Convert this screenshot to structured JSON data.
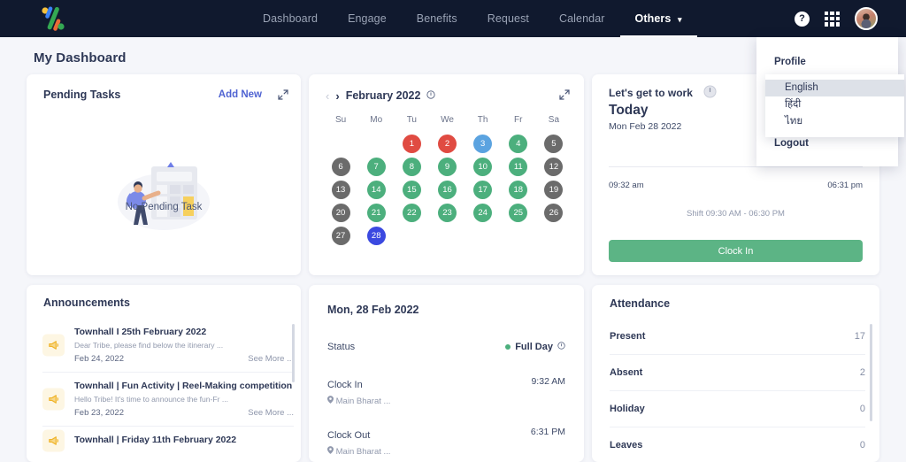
{
  "nav": {
    "logo_name": "percent-logo",
    "links": [
      {
        "label": "Dashboard",
        "active": false
      },
      {
        "label": "Engage",
        "active": false
      },
      {
        "label": "Benefits",
        "active": false
      },
      {
        "label": "Request",
        "active": false
      },
      {
        "label": "Calendar",
        "active": false
      },
      {
        "label": "Others",
        "active": true
      }
    ],
    "help_label": "?",
    "apps_icon": "grid-apps-icon",
    "avatar_icon": "user-avatar"
  },
  "profile_menu": {
    "profile_label": "Profile",
    "logout_label": "Logout",
    "languages": [
      {
        "label": "English",
        "selected": true
      },
      {
        "label": "हिंदी",
        "selected": false
      },
      {
        "label": "ไทย",
        "selected": false
      }
    ]
  },
  "page": {
    "title": "My Dashboard"
  },
  "pending_tasks": {
    "title": "Pending Tasks",
    "add_new": "Add New",
    "empty_text": "No Pending Task",
    "expand_icon": "expand-icon"
  },
  "announcements": {
    "title": "Announcements",
    "items": [
      {
        "title": "Townhall I 25th February 2022",
        "desc": "Dear Tribe, please find below the itinerary ...",
        "date": "Feb 24, 2022",
        "more": "See More ..."
      },
      {
        "title": "Townhall | Fun Activity | Reel-Making competition",
        "desc": "Hello Tribe! It's time to announce the fun-Fr ...",
        "date": "Feb 23, 2022",
        "more": "See More ..."
      },
      {
        "title": "Townhall | Friday 11th February 2022",
        "desc": "",
        "date": "",
        "more": ""
      }
    ]
  },
  "calendar": {
    "month_label": "February 2022",
    "prev_icon": "chevron-left-icon",
    "next_icon": "chevron-right-icon",
    "info_icon": "info-icon",
    "expand_icon": "expand-icon",
    "dow": [
      "Su",
      "Mo",
      "Tu",
      "We",
      "Th",
      "Fr",
      "Sa"
    ],
    "lead_blanks": 2,
    "days": [
      {
        "n": 1,
        "state": "red"
      },
      {
        "n": 2,
        "state": "red"
      },
      {
        "n": 3,
        "state": "lightblue"
      },
      {
        "n": 4,
        "state": "green"
      },
      {
        "n": 5,
        "state": "gray"
      },
      {
        "n": 6,
        "state": "gray"
      },
      {
        "n": 7,
        "state": "green"
      },
      {
        "n": 8,
        "state": "green"
      },
      {
        "n": 9,
        "state": "green"
      },
      {
        "n": 10,
        "state": "green"
      },
      {
        "n": 11,
        "state": "green"
      },
      {
        "n": 12,
        "state": "gray"
      },
      {
        "n": 13,
        "state": "gray"
      },
      {
        "n": 14,
        "state": "green"
      },
      {
        "n": 15,
        "state": "green"
      },
      {
        "n": 16,
        "state": "green"
      },
      {
        "n": 17,
        "state": "green"
      },
      {
        "n": 18,
        "state": "green"
      },
      {
        "n": 19,
        "state": "gray"
      },
      {
        "n": 20,
        "state": "gray"
      },
      {
        "n": 21,
        "state": "green"
      },
      {
        "n": 22,
        "state": "green"
      },
      {
        "n": 23,
        "state": "green"
      },
      {
        "n": 24,
        "state": "green"
      },
      {
        "n": 25,
        "state": "green"
      },
      {
        "n": 26,
        "state": "gray"
      },
      {
        "n": 27,
        "state": "gray"
      },
      {
        "n": 28,
        "state": "blue"
      }
    ],
    "colors": {
      "red": "#e04b42",
      "green": "#4caf7d",
      "gray": "#6b6b6b",
      "blue": "#3b49e0",
      "lightblue": "#5ba3e0"
    }
  },
  "day_detail": {
    "title": "Mon, 28 Feb 2022",
    "status_label": "Status",
    "status_value": "Full Day",
    "status_info_icon": "info-icon",
    "clock_in_label": "Clock In",
    "clock_in_location": "Main Bharat ...",
    "clock_in_time": "9:32 AM",
    "clock_out_label": "Clock Out",
    "clock_out_location": "Main Bharat ...",
    "clock_out_time": "6:31 PM",
    "pin_icon": "location-pin-icon"
  },
  "work": {
    "title": "Let's get to work",
    "clock_icon": "clock-icon",
    "today_label": "Today",
    "date": "Mon Feb 28 2022",
    "start_time": "09:32 am",
    "end_time": "06:31 pm",
    "shift": "Shift 09:30 AM - 06:30 PM",
    "button_label": "Clock In",
    "button_color": "#5cb485"
  },
  "attendance": {
    "title": "Attendance",
    "rows": [
      {
        "name": "Present",
        "value": "17"
      },
      {
        "name": "Absent",
        "value": "2"
      },
      {
        "name": "Holiday",
        "value": "0"
      },
      {
        "name": "Leaves",
        "value": "0"
      }
    ]
  },
  "theme": {
    "nav_bg": "#10192e",
    "page_bg": "#f5f6fa",
    "accent_blue": "#4f63d2",
    "text_dark": "#2e3856"
  }
}
